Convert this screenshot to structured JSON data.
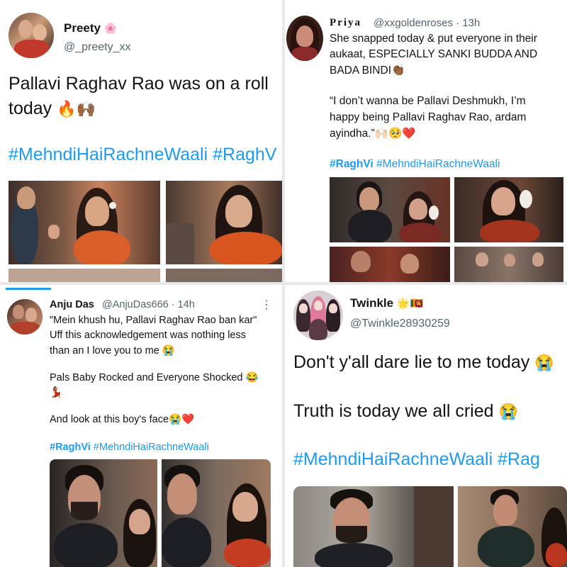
{
  "t1": {
    "name": "Preety",
    "name_emoji": "🌸",
    "handle": "@_preety_xx",
    "line1": "Pallavi Raghav Rao was on a roll",
    "line2": "today",
    "line2_emoji": "🔥🙌🏾",
    "hashtags": "#MehndiHaiRachneWaali #RaghV"
  },
  "t2": {
    "name": "Priya",
    "handle": "@xxgoldenroses",
    "time": "· 13h",
    "line1": "She snapped today & put everyone in their",
    "line2": "aukaat, ESPECIALLY SANKI BUDDA AND",
    "line3": "BADA BINDI",
    "line3_emoji": "👏🏾",
    "line4": "“I don’t wanna be Pallavi Deshmukh, I’m",
    "line5": "happy being Pallavi Raghav Rao, ardam",
    "line6": "ayindha.”",
    "line6_emoji": "🙌🏻🥺❤️",
    "hashtag1": "#RaghVi",
    "hashtag2": "#MehndiHaiRachneWaali"
  },
  "t3": {
    "name": "Anju Das",
    "handle": "@AnjuDas666",
    "time": "· 14h",
    "more": "⋮",
    "line1": "\"Mein khush hu, Pallavi Raghav Rao ban kar\"",
    "line2": "Uff this acknowledgement was nothing less",
    "line3": "than an I love you to me",
    "line3_emoji": "😭",
    "line4": "Pals Baby Rocked and Everyone Shocked",
    "line4_emoji": "😂",
    "line5_emoji": "💃🏽",
    "line6": "And look at this boy's face",
    "line6_emoji": "😭❤️",
    "hashtag1": "#RaghVi",
    "hashtag2": "#MehndiHaiRachneWaali"
  },
  "t4": {
    "name": "Twinkle",
    "name_emoji": "🌟🇱🇰",
    "handle": "@Twinkle28930259",
    "line1": "Don't y'all dare lie to me today",
    "line1_emoji": "😭",
    "line2": "Truth is today we all cried",
    "line2_emoji": "😭",
    "hashtags": "#MehndiHaiRachneWaali #Rag"
  },
  "colors": {
    "link": "#1d9bf0",
    "handle": "#536471",
    "text": "#0f1419"
  }
}
